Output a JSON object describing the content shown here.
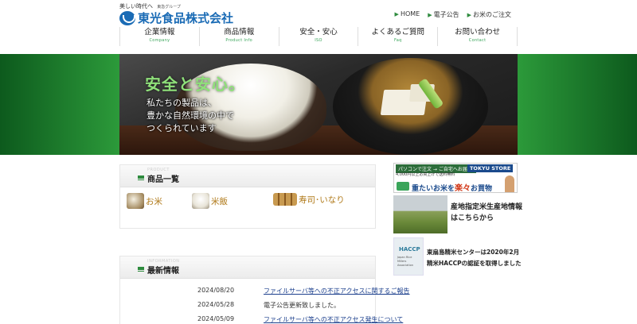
{
  "header": {
    "tagline": "美しい時代へ",
    "tagline_sub": "東急グループ",
    "logo_text": "東光食品株式会社",
    "utility": [
      "HOME",
      "電子公告",
      "お米のご注文"
    ]
  },
  "gnav": [
    {
      "jp": "企業情報",
      "en": "Company"
    },
    {
      "jp": "商品情報",
      "en": "Product Info"
    },
    {
      "jp": "安全・安心",
      "en": "ISO"
    },
    {
      "jp": "よくあるご質問",
      "en": "Faq"
    },
    {
      "jp": "お問い合わせ",
      "en": "Contact"
    }
  ],
  "hero": {
    "headline": "安全と安心。",
    "copy": [
      "私たちの製品は、",
      "豊かな自然環境の中で",
      "つくられています"
    ]
  },
  "products_panel": {
    "ghost": "PRODUCT",
    "title": "商品一覧",
    "items": [
      {
        "label": "お米",
        "icon": "rice-bag-icon"
      },
      {
        "label": "米飯",
        "icon": "cooked-rice-icon"
      },
      {
        "label": "寿司･いなり",
        "icon": "sushi-icon"
      }
    ]
  },
  "news_panel": {
    "ghost": "INFORMATION",
    "title": "最新情報",
    "items": [
      {
        "date": "2024/08/20",
        "text": "ファイルサーバ等への不正アクセスに関するご報告",
        "link": true
      },
      {
        "date": "2024/05/28",
        "text": "電子公告更新致しました。",
        "link": false
      },
      {
        "date": "2024/05/09",
        "text": "ファイルサーバ等への不正アクセス発生について",
        "link": true
      }
    ]
  },
  "sidebar": {
    "tokyu": {
      "pc_order": "パソコンで注文 → ご自宅へお届け!",
      "store": "TOKYU STORE",
      "note": "4,000円以上お買上げで送料無料",
      "main_pre": "重たいお米を",
      "main_em": "楽々",
      "main_post": "お買物"
    },
    "field": {
      "lines": [
        "産地指定米生産地情報",
        "はこちらから"
      ]
    },
    "haccp": {
      "logo": "HACCP",
      "logo_sub": "Japan Rice Millers Association",
      "lines": [
        "東扇島精米センターは2020年2月",
        "精米HACCPの認証を取得しました"
      ]
    }
  }
}
